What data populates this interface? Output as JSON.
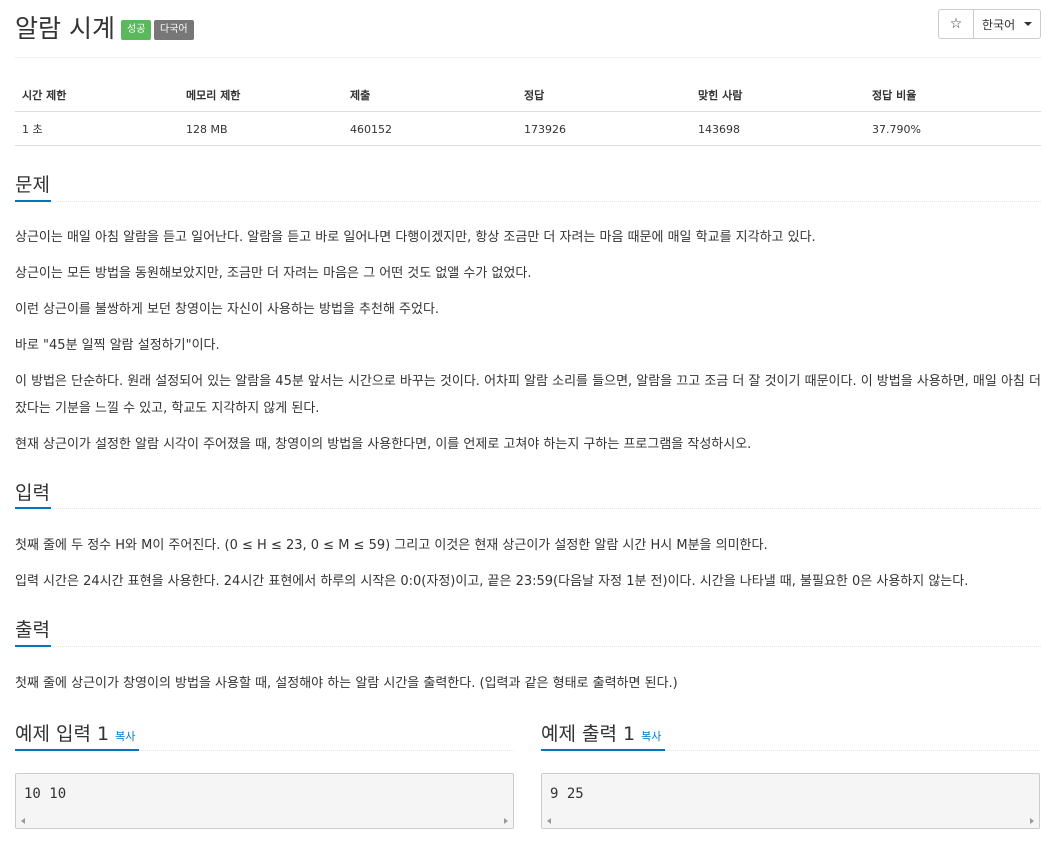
{
  "header": {
    "title": "알람 시계",
    "badge_success": "성공",
    "badge_lang": "다국어",
    "star_icon": "☆",
    "language": "한국어"
  },
  "stats": {
    "headers": [
      "시간 제한",
      "메모리 제한",
      "제출",
      "정답",
      "맞힌 사람",
      "정답 비율"
    ],
    "values": [
      "1 초",
      "128 MB",
      "460152",
      "173926",
      "143698",
      "37.790%"
    ]
  },
  "problem": {
    "title": "문제",
    "paragraphs": [
      "상근이는 매일 아침 알람을 듣고 일어난다. 알람을 듣고 바로 일어나면 다행이겠지만, 항상 조금만 더 자려는 마음 때문에 매일 학교를 지각하고 있다.",
      "상근이는 모든 방법을 동원해보았지만, 조금만 더 자려는 마음은 그 어떤 것도 없앨 수가 없었다.",
      "이런 상근이를 불쌍하게 보던 창영이는 자신이 사용하는 방법을 추천해 주었다.",
      "바로 \"45분 일찍 알람 설정하기\"이다.",
      "이 방법은 단순하다. 원래 설정되어 있는 알람을 45분 앞서는 시간으로 바꾸는 것이다. 어차피 알람 소리를 들으면, 알람을 끄고 조금 더 잘 것이기 때문이다. 이 방법을 사용하면, 매일 아침 더 잤다는 기분을 느낄 수 있고, 학교도 지각하지 않게 된다.",
      "현재 상근이가 설정한 알람 시각이 주어졌을 때, 창영이의 방법을 사용한다면, 이를 언제로 고쳐야 하는지 구하는 프로그램을 작성하시오."
    ]
  },
  "input": {
    "title": "입력",
    "paragraphs": [
      "첫째 줄에 두 정수 H와 M이 주어진다. (0 ≤ H ≤ 23, 0 ≤ M ≤ 59) 그리고 이것은 현재 상근이가 설정한 알람 시간 H시 M분을 의미한다.",
      "입력 시간은 24시간 표현을 사용한다. 24시간 표현에서 하루의 시작은 0:0(자정)이고, 끝은 23:59(다음날 자정 1분 전)이다. 시간을 나타낼 때, 불필요한 0은 사용하지 않는다."
    ]
  },
  "output": {
    "title": "출력",
    "paragraphs": [
      "첫째 줄에 상근이가 창영이의 방법을 사용할 때, 설정해야 하는 알람 시간을 출력한다. (입력과 같은 형태로 출력하면 된다.)"
    ]
  },
  "samples": {
    "input_title": "예제 입력 1",
    "output_title": "예제 출력 1",
    "copy_label": "복사",
    "input_value": "10 10",
    "output_value": "9 25"
  }
}
